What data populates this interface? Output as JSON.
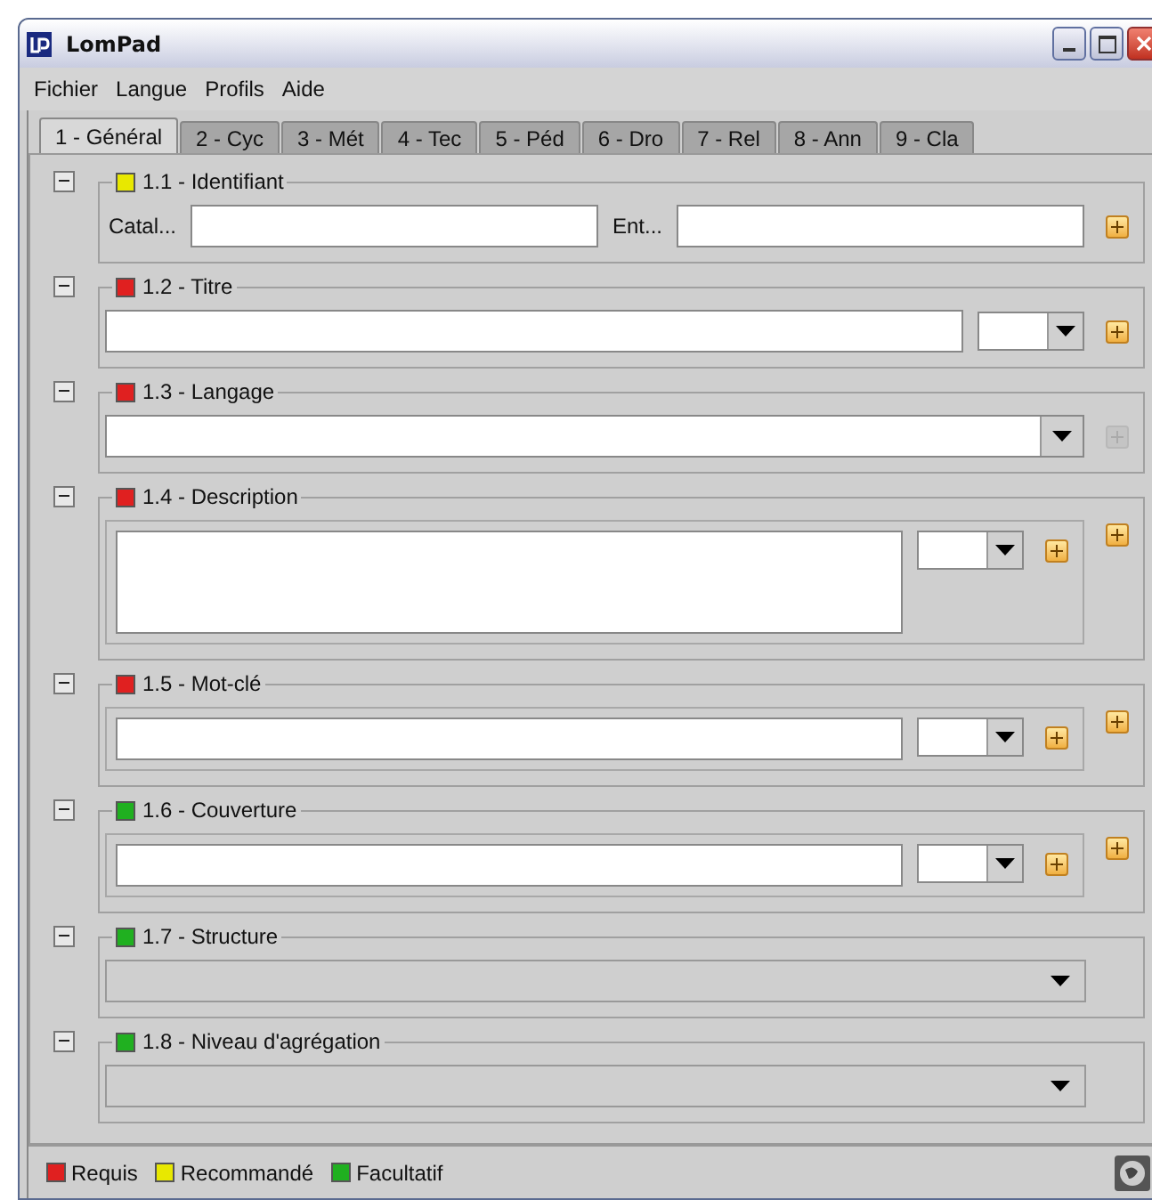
{
  "window": {
    "title": "LomPad"
  },
  "menu": [
    "Fichier",
    "Langue",
    "Profils",
    "Aide"
  ],
  "tabs": [
    {
      "label": "1 - Général",
      "selected": true
    },
    {
      "label": "2 - Cyc",
      "selected": false
    },
    {
      "label": "3 - Mét",
      "selected": false
    },
    {
      "label": "4 - Tec",
      "selected": false
    },
    {
      "label": "5 - Péd",
      "selected": false
    },
    {
      "label": "6 - Dro",
      "selected": false
    },
    {
      "label": "7 - Rel",
      "selected": false
    },
    {
      "label": "8 - Ann",
      "selected": false
    },
    {
      "label": "9 - Cla",
      "selected": false
    }
  ],
  "sections": [
    {
      "title": "1.1 - Identifiant",
      "color": "#e8e800",
      "kind": "identifier",
      "fields": [
        "Catal...",
        "Ent..."
      ],
      "add_disabled": false
    },
    {
      "title": "1.2 - Titre",
      "color": "#e02020",
      "kind": "text_lang",
      "add_disabled": false
    },
    {
      "title": "1.3 - Langage",
      "color": "#e02020",
      "kind": "combo",
      "add_disabled": true
    },
    {
      "title": "1.4 - Description",
      "color": "#e02020",
      "kind": "textarea_lang",
      "add_disabled": false
    },
    {
      "title": "1.5 - Mot-clé",
      "color": "#e02020",
      "kind": "boxed_text_lang",
      "add_disabled": false
    },
    {
      "title": "1.6 - Couverture",
      "color": "#20b020",
      "kind": "boxed_text_lang",
      "add_disabled": false
    },
    {
      "title": "1.7 - Structure",
      "color": "#20b020",
      "kind": "select"
    },
    {
      "title": "1.8 - Niveau d'agrégation",
      "color": "#20b020",
      "kind": "select"
    }
  ],
  "legend": [
    {
      "label": "Requis",
      "color": "#e02020"
    },
    {
      "label": "Recommandé",
      "color": "#e8e800"
    },
    {
      "label": "Facultatif",
      "color": "#20b020"
    }
  ]
}
